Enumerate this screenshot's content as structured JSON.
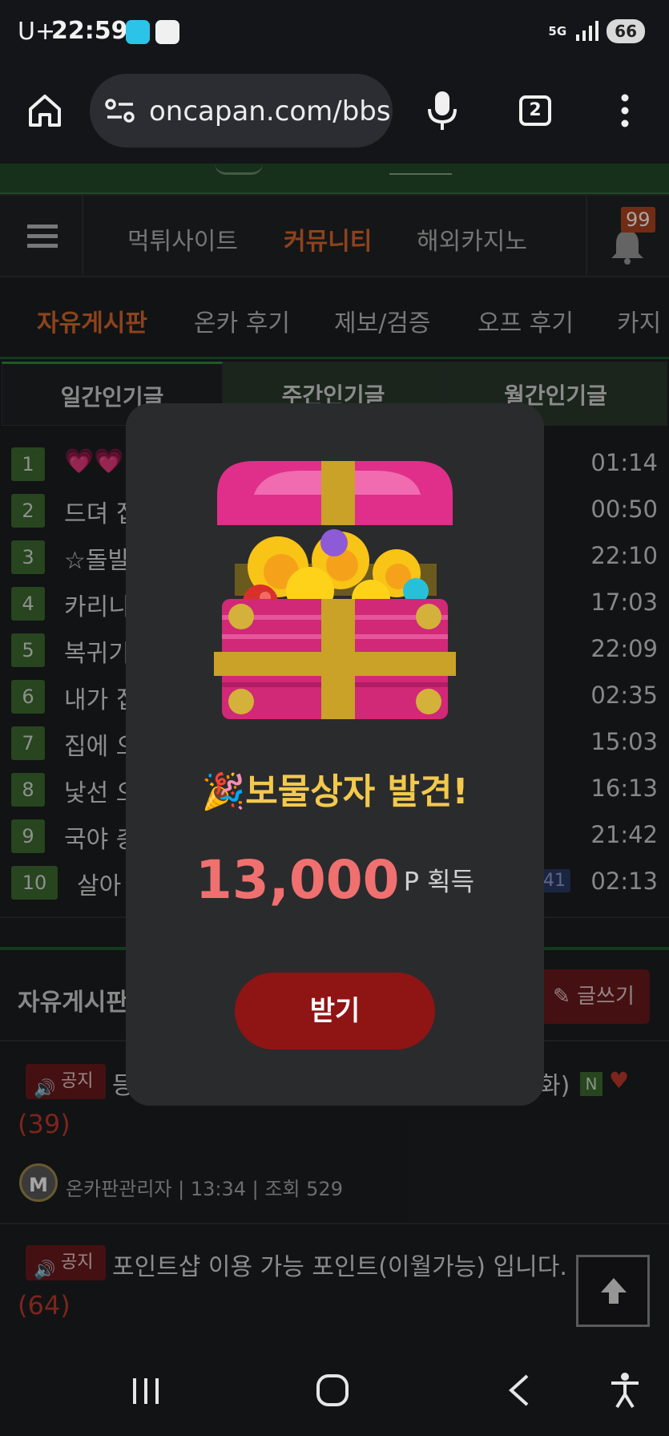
{
  "status_bar": {
    "carrier": "U+",
    "time": "22:59",
    "network": "5G",
    "battery": "66"
  },
  "browser": {
    "url": "oncapan.com/bbs",
    "tab_count": "2"
  },
  "main_nav": {
    "items": [
      "먹튀사이트",
      "커뮤니티",
      "해외카지노"
    ],
    "active_index": 1,
    "notification_count": "99"
  },
  "sub_nav": {
    "items": [
      "자유게시판",
      "온카 후기",
      "제보/검증",
      "오프 후기",
      "카지"
    ],
    "active_index": 0
  },
  "popular_tabs": [
    "일간인기글",
    "주간인기글",
    "월간인기글"
  ],
  "ranked_posts": [
    {
      "rank": "1",
      "title": "💗💗",
      "time": "01:14"
    },
    {
      "rank": "2",
      "title": "드뎌 집",
      "time": "00:50"
    },
    {
      "rank": "3",
      "title": "☆돌발",
      "time": "22:10"
    },
    {
      "rank": "4",
      "title": "카리니",
      "time": "17:03"
    },
    {
      "rank": "5",
      "title": "복귀기",
      "time": "22:09"
    },
    {
      "rank": "6",
      "title": "내가 집",
      "time": "02:35"
    },
    {
      "rank": "7",
      "title": "집에 오",
      "time": "15:03"
    },
    {
      "rank": "8",
      "title": "낯선 오",
      "time": "16:13"
    },
    {
      "rank": "9",
      "title": "국야 충",
      "time": "21:42"
    },
    {
      "rank": "10",
      "title": "살아",
      "time": "02:13",
      "comment_badge": "41"
    }
  ],
  "board": {
    "title": "자유게시판",
    "write_label": "글쓰기",
    "posts": [
      {
        "tag": "공지",
        "title_start": "등",
        "title_end": "화)",
        "new_badge": "N",
        "count": "(39)",
        "author": "온카판관리자",
        "time": "13:34",
        "views_label": "조회",
        "views": "529",
        "avatar": "M"
      },
      {
        "tag": "공지",
        "title": "포인트샵 이용 가능 포인트(이월가능) 입니다.",
        "count": "(64)"
      }
    ]
  },
  "modal": {
    "title_emoji": "🎉",
    "title": "보물상자 발견!",
    "amount": "13,000",
    "unit": "P 획득",
    "claim_label": "받기"
  },
  "colors": {
    "accent_orange": "#d9682b",
    "green_rank": "#3c6b2f",
    "claim_red": "#8f1414",
    "amount_red": "#f07070",
    "title_gold": "#f2c94c"
  }
}
